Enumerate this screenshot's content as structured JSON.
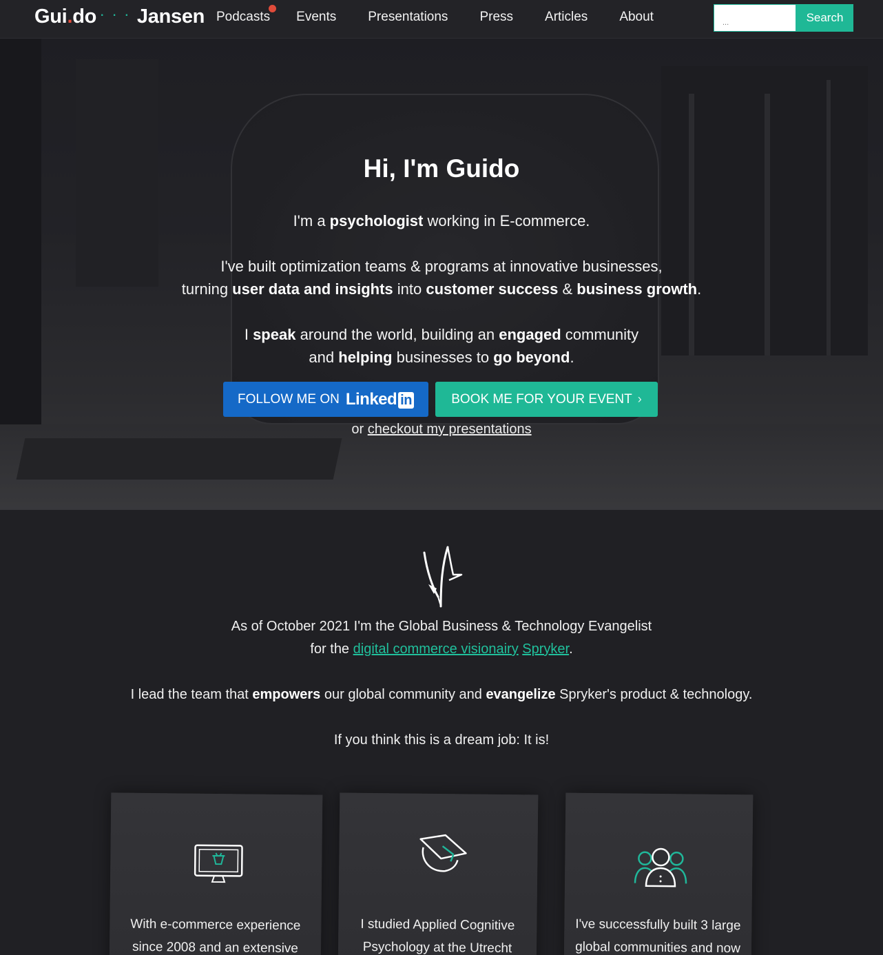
{
  "nav": {
    "logo": {
      "part1": "Gui",
      "dot": ".",
      "part2": "do",
      "sep": "· · ·",
      "part3": "Jansen"
    },
    "links": [
      {
        "label": "Podcasts",
        "has_notification": true
      },
      {
        "label": "Events"
      },
      {
        "label": "Presentations"
      },
      {
        "label": "Press"
      },
      {
        "label": "Articles"
      },
      {
        "label": "About"
      }
    ],
    "search": {
      "placeholder": "...",
      "value": "",
      "button_label": "Search"
    }
  },
  "hero": {
    "title": "Hi, I'm Guido",
    "line1": {
      "a": "I'm a ",
      "b": "psychologist",
      "c": " working in E-commerce."
    },
    "line2": "I've built optimization teams & programs at innovative businesses,",
    "line3": {
      "a": "turning ",
      "b": "user data and insights",
      "c": " into ",
      "d": "customer success",
      "e": " & ",
      "f": "business growth",
      "g": "."
    },
    "line4": {
      "a": "I ",
      "b": "speak",
      "c": " around the world, building an ",
      "d": "engaged",
      "e": " community"
    },
    "line5": {
      "a": "and ",
      "b": "helping",
      "c": " businesses to ",
      "d": "go beyond",
      "e": "."
    },
    "linkedin_button": {
      "label": "FOLLOW ME ON",
      "brand": "Linked",
      "brand_box": "in"
    },
    "book_button": {
      "label": "BOOK ME FOR YOUR EVENT",
      "chevron": "›"
    },
    "or_line": {
      "prefix": "or ",
      "link": "checkout my presentations"
    }
  },
  "intro": {
    "p1a": "As of October 2021 I'm the Global Business & Technology Evangelist",
    "p1b_prefix": "for the ",
    "p1b_link1": "digital commerce visionairy",
    "p1b_space": " ",
    "p1b_link2": "Spryker",
    "p1b_suffix": ".",
    "p2": {
      "a": "I lead the team that ",
      "b": "empowers",
      "c": " our global community and ",
      "d": "evangelize",
      "e": " Spryker's product & technology."
    },
    "p3": "If you think this is a dream job: It is!"
  },
  "cards": [
    {
      "icon": "ecommerce-monitor-icon",
      "line1": "With e-commerce experience",
      "line2": "since 2008 and an extensive"
    },
    {
      "icon": "graduation-cap-icon",
      "line1": "I studied Applied Cognitive",
      "line2": "Psychology at the Utrecht"
    },
    {
      "icon": "community-people-icon",
      "line1": "I've successfully built 3 large",
      "line2": "global communities and now"
    }
  ],
  "colors": {
    "accent": "#1fb896",
    "linkedin": "#1569c7",
    "notification": "#e04b3a",
    "background": "#202024"
  }
}
